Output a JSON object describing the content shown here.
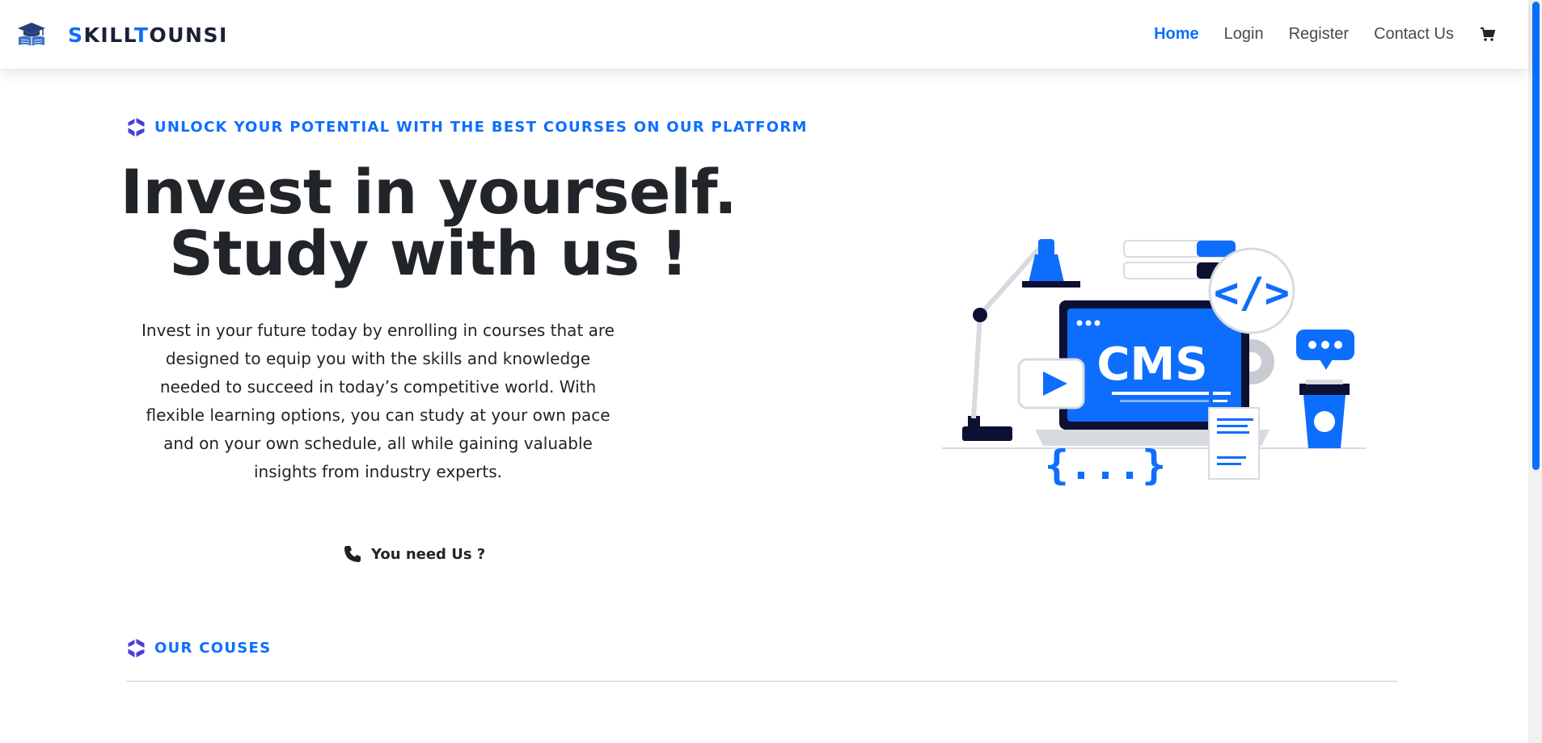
{
  "brand": {
    "name_accent_1": "S",
    "name_part_1": "KILL",
    "name_accent_2": "T",
    "name_part_2": "OUNSI",
    "logo_icon": "graduation-cap-book-icon"
  },
  "nav": {
    "items": [
      {
        "label": "Home",
        "active": true
      },
      {
        "label": "Login",
        "active": false
      },
      {
        "label": "Register",
        "active": false
      },
      {
        "label": "Contact Us",
        "active": false
      }
    ],
    "cart_icon": "cart-icon"
  },
  "hero": {
    "eyebrow": "UNLOCK YOUR POTENTIAL WITH THE BEST COURSES ON OUR PLATFORM",
    "title_line1": "Invest in yourself.",
    "title_line2": "Study with us !",
    "description": "Invest in your future today by enrolling in courses that are designed to equip you with the skills and knowledge needed to succeed in today’s competitive world. With flexible learning options, you can study at your own pace and on your own schedule, all while gaining valuable insights from industry experts.",
    "cta_label": "You need Us ?",
    "cta_icon": "phone-icon"
  },
  "illustration": {
    "screen_text": "CMS",
    "code_icon_text": "</>",
    "braces_text": "{...}"
  },
  "courses": {
    "heading": "OUR COUSES"
  },
  "colors": {
    "accent": "#0d6efd",
    "dark": "#212529",
    "logo_purple": "#4b3fd1"
  }
}
